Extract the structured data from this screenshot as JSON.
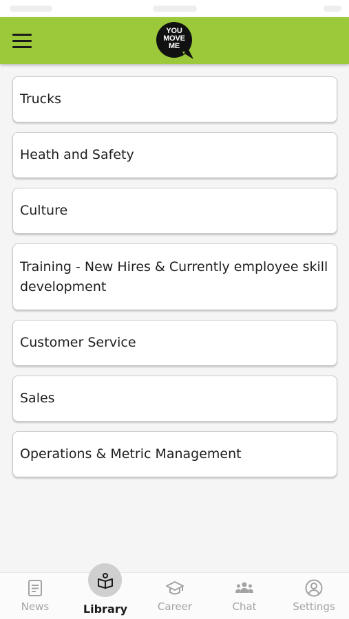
{
  "app": {
    "logo_lines": [
      "YOU",
      "MOVE",
      "ME"
    ],
    "brand_color": "#9bc93a"
  },
  "header": {
    "menu_icon": "hamburger-menu-icon"
  },
  "library": {
    "categories": [
      "Trucks",
      "Heath and Safety",
      "Culture",
      "Training - New Hires & Currently employee skill development",
      "Customer Service",
      "Sales",
      "Operations & Metric Management"
    ]
  },
  "tabbar": {
    "tabs": [
      {
        "label": "News",
        "icon": "news-document-icon",
        "active": false
      },
      {
        "label": "Library",
        "icon": "library-book-icon",
        "active": true
      },
      {
        "label": "Career",
        "icon": "graduation-cap-icon",
        "active": false
      },
      {
        "label": "Chat",
        "icon": "group-people-icon",
        "active": false
      },
      {
        "label": "Settings",
        "icon": "user-circle-icon",
        "active": false
      }
    ]
  }
}
